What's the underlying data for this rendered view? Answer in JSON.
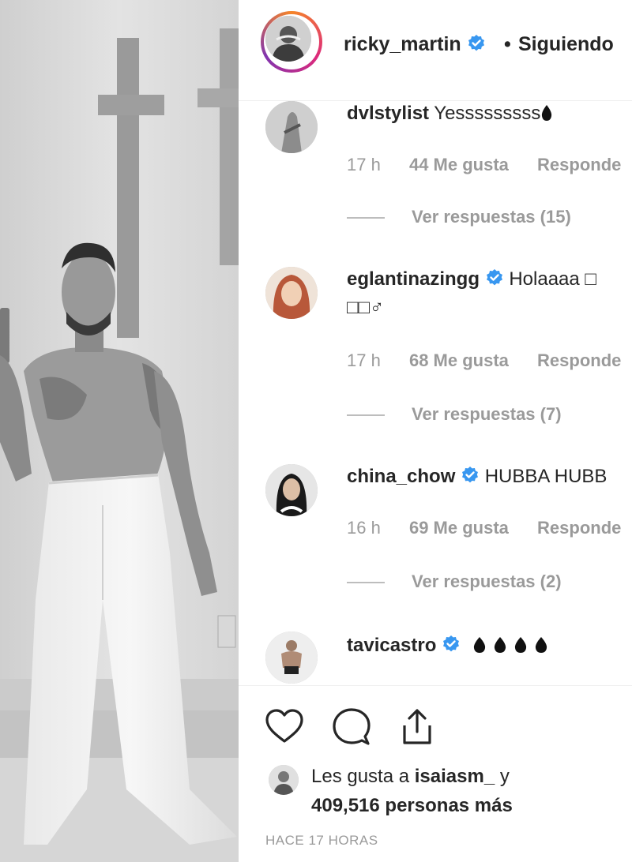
{
  "header": {
    "username": "ricky_martin",
    "separator": "•",
    "follow_status": "Siguiendo"
  },
  "comments": [
    {
      "username": "dvlstylist",
      "text": "Yesssssssss",
      "verified": false,
      "time": "17 h",
      "likes": "44 Me gusta",
      "reply_label": "Responde",
      "view_replies": "Ver respuestas (15)"
    },
    {
      "username": "eglantinazingg",
      "text": "Holaaaa □",
      "text_line2": "□□♂",
      "verified": true,
      "time": "17 h",
      "likes": "68 Me gusta",
      "reply_label": "Responde",
      "view_replies": "Ver respuestas (7)"
    },
    {
      "username": "china_chow",
      "text": "HUBBA HUBB",
      "verified": true,
      "time": "16 h",
      "likes": "69 Me gusta",
      "reply_label": "Responde",
      "view_replies": "Ver respuestas (2)"
    },
    {
      "username": "tavicastro",
      "text": "",
      "verified": true
    }
  ],
  "footer": {
    "likes_prefix": "Les gusta a ",
    "liked_by": "isaiasm_",
    "likes_mid": " y",
    "likes_count": "409,516 personas más",
    "time_ago": "HACE 17 HORAS"
  },
  "icons": {
    "like": "heart-outline-icon",
    "comment": "comment-bubble-icon",
    "share": "share-upload-icon",
    "verified": "verified-badge-icon",
    "fire": "fire-drop-icon"
  },
  "colors": {
    "verified_blue": "#3897f0",
    "meta_gray": "#9a9a9a",
    "text": "#262626"
  }
}
